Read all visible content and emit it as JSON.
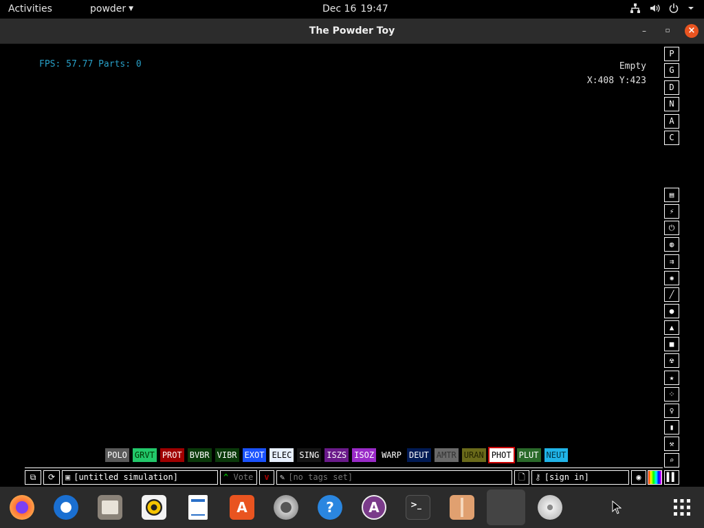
{
  "topbar": {
    "activities": "Activities",
    "app_name": "powder",
    "date": "Dec 16",
    "time": "19:47"
  },
  "window": {
    "title": "The Powder Toy",
    "minimize": "–",
    "maximize": "▫",
    "close": "×"
  },
  "hud": {
    "fps_text": "FPS: 57.77 Parts: 0",
    "hover_element": "Empty",
    "coords": "X:408 Y:423"
  },
  "side_buttons_top": [
    "P",
    "G",
    "D",
    "N",
    "A",
    "C"
  ],
  "elements": [
    {
      "label": "POLO",
      "bg": "#5a5a5a",
      "fg": "#ffffff"
    },
    {
      "label": "GRVT",
      "bg": "#22c86a",
      "fg": "#003300"
    },
    {
      "label": "PROT",
      "bg": "#a00000",
      "fg": "#ffffff"
    },
    {
      "label": "BVBR",
      "bg": "#0a3a0a",
      "fg": "#ffffff"
    },
    {
      "label": "VIBR",
      "bg": "#0a3a0a",
      "fg": "#ffffff"
    },
    {
      "label": "EXOT",
      "bg": "#1a52ff",
      "fg": "#ffffff"
    },
    {
      "label": "ELEC",
      "bg": "#e8f0ff",
      "fg": "#000000"
    },
    {
      "label": "SING",
      "bg": "#151515",
      "fg": "#ffffff"
    },
    {
      "label": "ISZS",
      "bg": "#6a1a8a",
      "fg": "#ffffff"
    },
    {
      "label": "ISOZ",
      "bg": "#9a2ac8",
      "fg": "#ffffff"
    },
    {
      "label": "WARP",
      "bg": "#000000",
      "fg": "#ffffff"
    },
    {
      "label": "DEUT",
      "bg": "#001a55",
      "fg": "#ffffff"
    },
    {
      "label": "AMTR",
      "bg": "#6a6a6a",
      "fg": "#333333"
    },
    {
      "label": "URAN",
      "bg": "#6a6a1a",
      "fg": "#222200"
    },
    {
      "label": "PHOT",
      "bg": "#ffffff",
      "fg": "#000000",
      "selected": true
    },
    {
      "label": "PLUT",
      "bg": "#2a6a2a",
      "fg": "#ffffff"
    },
    {
      "label": "NEUT",
      "bg": "#20b4e8",
      "fg": "#003344"
    }
  ],
  "bottombar": {
    "save_name": "[untitled simulation]",
    "vote_label": "Vote",
    "tags": "[no tags set]",
    "sign_in": "[sign in]"
  },
  "dock": {
    "items": [
      "firefox-icon",
      "thunderbird-icon",
      "files-icon",
      "rhythmbox-icon",
      "writer-icon",
      "app-center-icon",
      "settings-icon",
      "help-icon",
      "app-store-icon",
      "terminal-icon",
      "archive-icon",
      "powder-toy-icon",
      "disc-icon",
      "show-apps-icon"
    ]
  }
}
